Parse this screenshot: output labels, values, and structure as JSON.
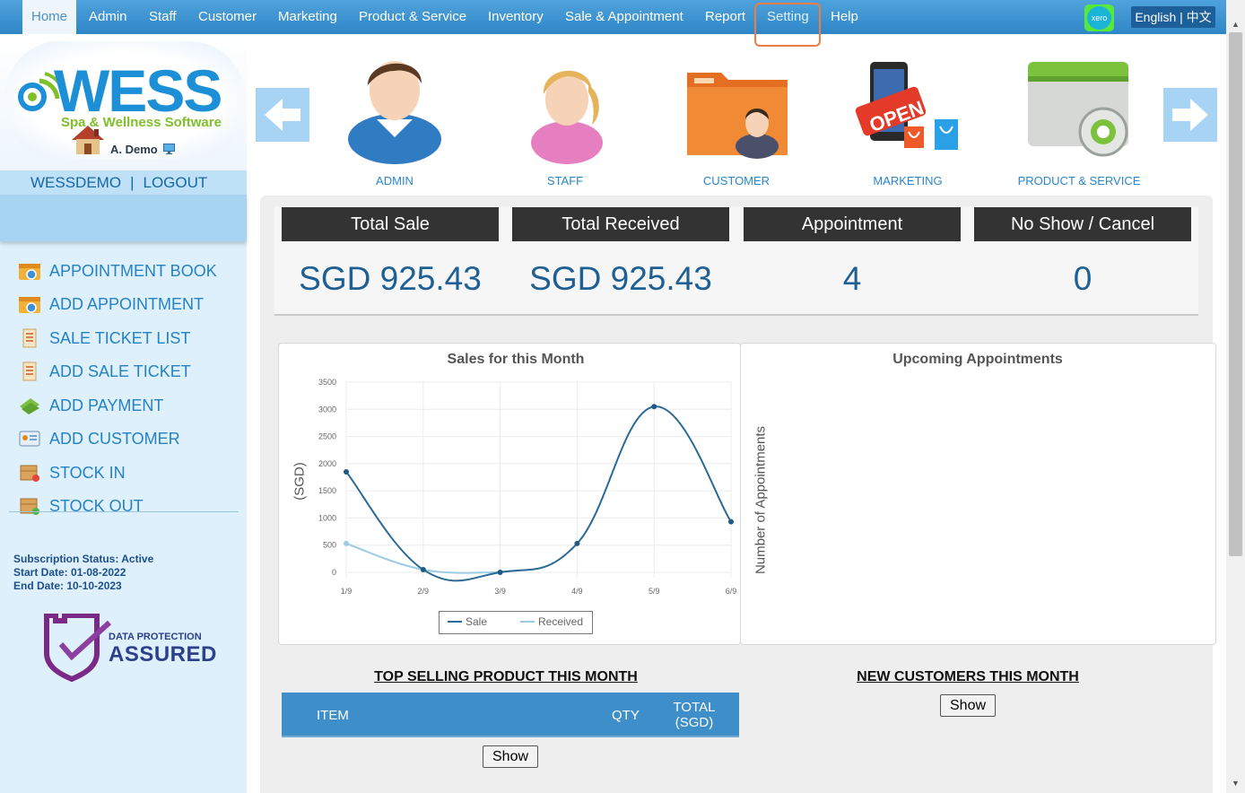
{
  "nav": {
    "items": [
      "Home",
      "Admin",
      "Staff",
      "Customer",
      "Marketing",
      "Product & Service",
      "Inventory",
      "Sale & Appointment",
      "Report",
      "Setting",
      "Help"
    ],
    "xero_label": "xero",
    "language": "English | 中文"
  },
  "sidebar": {
    "logo_text": "WESS",
    "logo_subtitle": "Spa & Wellness Software",
    "user_name": "A. Demo",
    "account": "WESSDEMO",
    "separator": "|",
    "logout": "LOGOUT",
    "menu": [
      {
        "label": "APPOINTMENT BOOK",
        "icon": "appointment-book-icon"
      },
      {
        "label": "ADD APPOINTMENT",
        "icon": "add-appointment-icon"
      },
      {
        "label": "SALE TICKET LIST",
        "icon": "sale-ticket-list-icon"
      },
      {
        "label": "ADD SALE TICKET",
        "icon": "add-sale-ticket-icon"
      },
      {
        "label": "ADD PAYMENT",
        "icon": "add-payment-icon"
      },
      {
        "label": "ADD CUSTOMER",
        "icon": "add-customer-icon"
      },
      {
        "label": "STOCK IN",
        "icon": "stock-in-icon"
      },
      {
        "label": "STOCK OUT",
        "icon": "stock-out-icon"
      }
    ],
    "subscription_status": "Subscription Status: Active",
    "start_date": "Start Date: 01-08-2022",
    "end_date": "End Date: 10-10-2023",
    "badge_line1": "DATA PROTECTION",
    "badge_line2": "ASSURED"
  },
  "quick_links": [
    {
      "label": "ADMIN",
      "icon": "admin-avatar-icon"
    },
    {
      "label": "STAFF",
      "icon": "staff-avatar-icon"
    },
    {
      "label": "CUSTOMER",
      "icon": "customer-folder-icon"
    },
    {
      "label": "MARKETING",
      "icon": "marketing-open-sign-icon"
    },
    {
      "label": "PRODUCT & SERVICE",
      "icon": "product-service-gear-icon"
    }
  ],
  "stats": [
    {
      "label": "Total Sale",
      "value": "SGD 925.43"
    },
    {
      "label": "Total Received",
      "value": "SGD 925.43"
    },
    {
      "label": "Appointment",
      "value": "4"
    },
    {
      "label": "No Show / Cancel",
      "value": "0"
    }
  ],
  "chart_data": {
    "type": "line",
    "title": "Sales for this Month",
    "xlabel": "",
    "ylabel": "(SGD)",
    "categories": [
      "1/9",
      "2/9",
      "3/9",
      "4/9",
      "5/9",
      "6/9"
    ],
    "series": [
      {
        "name": "Sale",
        "values": [
          1850,
          50,
          0,
          530,
          3050,
          930
        ]
      },
      {
        "name": "Received",
        "values": [
          530,
          50,
          0,
          0,
          0,
          0
        ]
      }
    ],
    "ylim": [
      0,
      3500
    ],
    "yticks": [
      0,
      500,
      1000,
      1500,
      2000,
      2500,
      3000,
      3500
    ],
    "grid": true,
    "legend": "bottom",
    "colors": {
      "Sale": "#2a6a96",
      "Received": "#9ccbe3"
    }
  },
  "appointments_chart": {
    "title": "Upcoming Appointments",
    "ylabel": "Number of Appointments"
  },
  "top_selling": {
    "title": "TOP SELLING PRODUCT THIS MONTH",
    "columns": [
      "ITEM",
      "QTY",
      "TOTAL (SGD)"
    ],
    "show_label": "Show"
  },
  "new_customers": {
    "title": "NEW CUSTOMERS THIS MONTH",
    "show_label": "Show"
  }
}
